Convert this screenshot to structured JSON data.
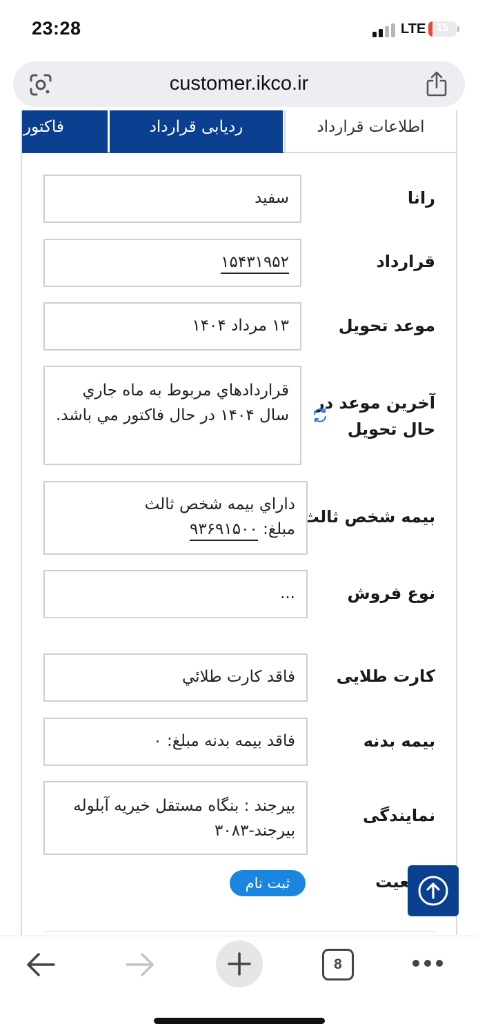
{
  "status_bar": {
    "time": "23:28",
    "network": "LTE",
    "battery_level": "15",
    "battery_fraction": 0.15,
    "battery_color": "#e5483b"
  },
  "browser": {
    "url": "customer.ikco.ir",
    "icons": {
      "lens": "google-lens-icon",
      "share": "share-icon"
    }
  },
  "tabs": {
    "factor": "فاکتور",
    "tracking": "ردیابی قرارداد",
    "info": "اطلاعات قرارداد"
  },
  "rows": {
    "car": {
      "label": "رانا",
      "value": "سفید"
    },
    "contract": {
      "label": "قرارداد",
      "value": "۱۵۴۳۱۹۵۲"
    },
    "delivery": {
      "label": "موعد تحویل",
      "value": "۱۳ مرداد ۱۴۰۴"
    },
    "last_delivery": {
      "label_line1": "آخرین موعد در",
      "label_line2": "حال تحویل",
      "value": "قراردادهاي مربوط به ماه جاري سال ۱۴۰۴ در حال فاکتور مي باشد."
    },
    "insurance_third": {
      "label": "بیمه شخص ثالث",
      "value_line1": "داراي بيمه شخص ثالث",
      "amount_prefix": "مبلغ:",
      "amount": "۹۳۶۹۱۵۰۰"
    },
    "sale_type": {
      "label": "نوع فروش",
      "value": "..."
    },
    "golden_card": {
      "label": "کارت طلایی",
      "value": "فاقد کارت طلائي"
    },
    "body_insurance": {
      "label": "بیمه بدنه",
      "value": "فاقد بیمه بدنه مبلغ: ۰"
    },
    "agency": {
      "label": "نمایندگی",
      "value_line1": "بيرجند : بنگاه مستقل خيريه آبلوله",
      "value_line2": "بيرجند-۳۰۸۳"
    },
    "status": {
      "label": "وضعیت",
      "badge": "ثبت نام"
    }
  },
  "colors": {
    "brand_blue": "#0b3f8f",
    "badge_blue": "#1b86e0"
  },
  "toolbar": {
    "back": "back-arrow-icon",
    "forward": "forward-arrow-icon",
    "new_tab": "plus-icon",
    "tab_count": "8",
    "more": "more-dots-icon"
  }
}
